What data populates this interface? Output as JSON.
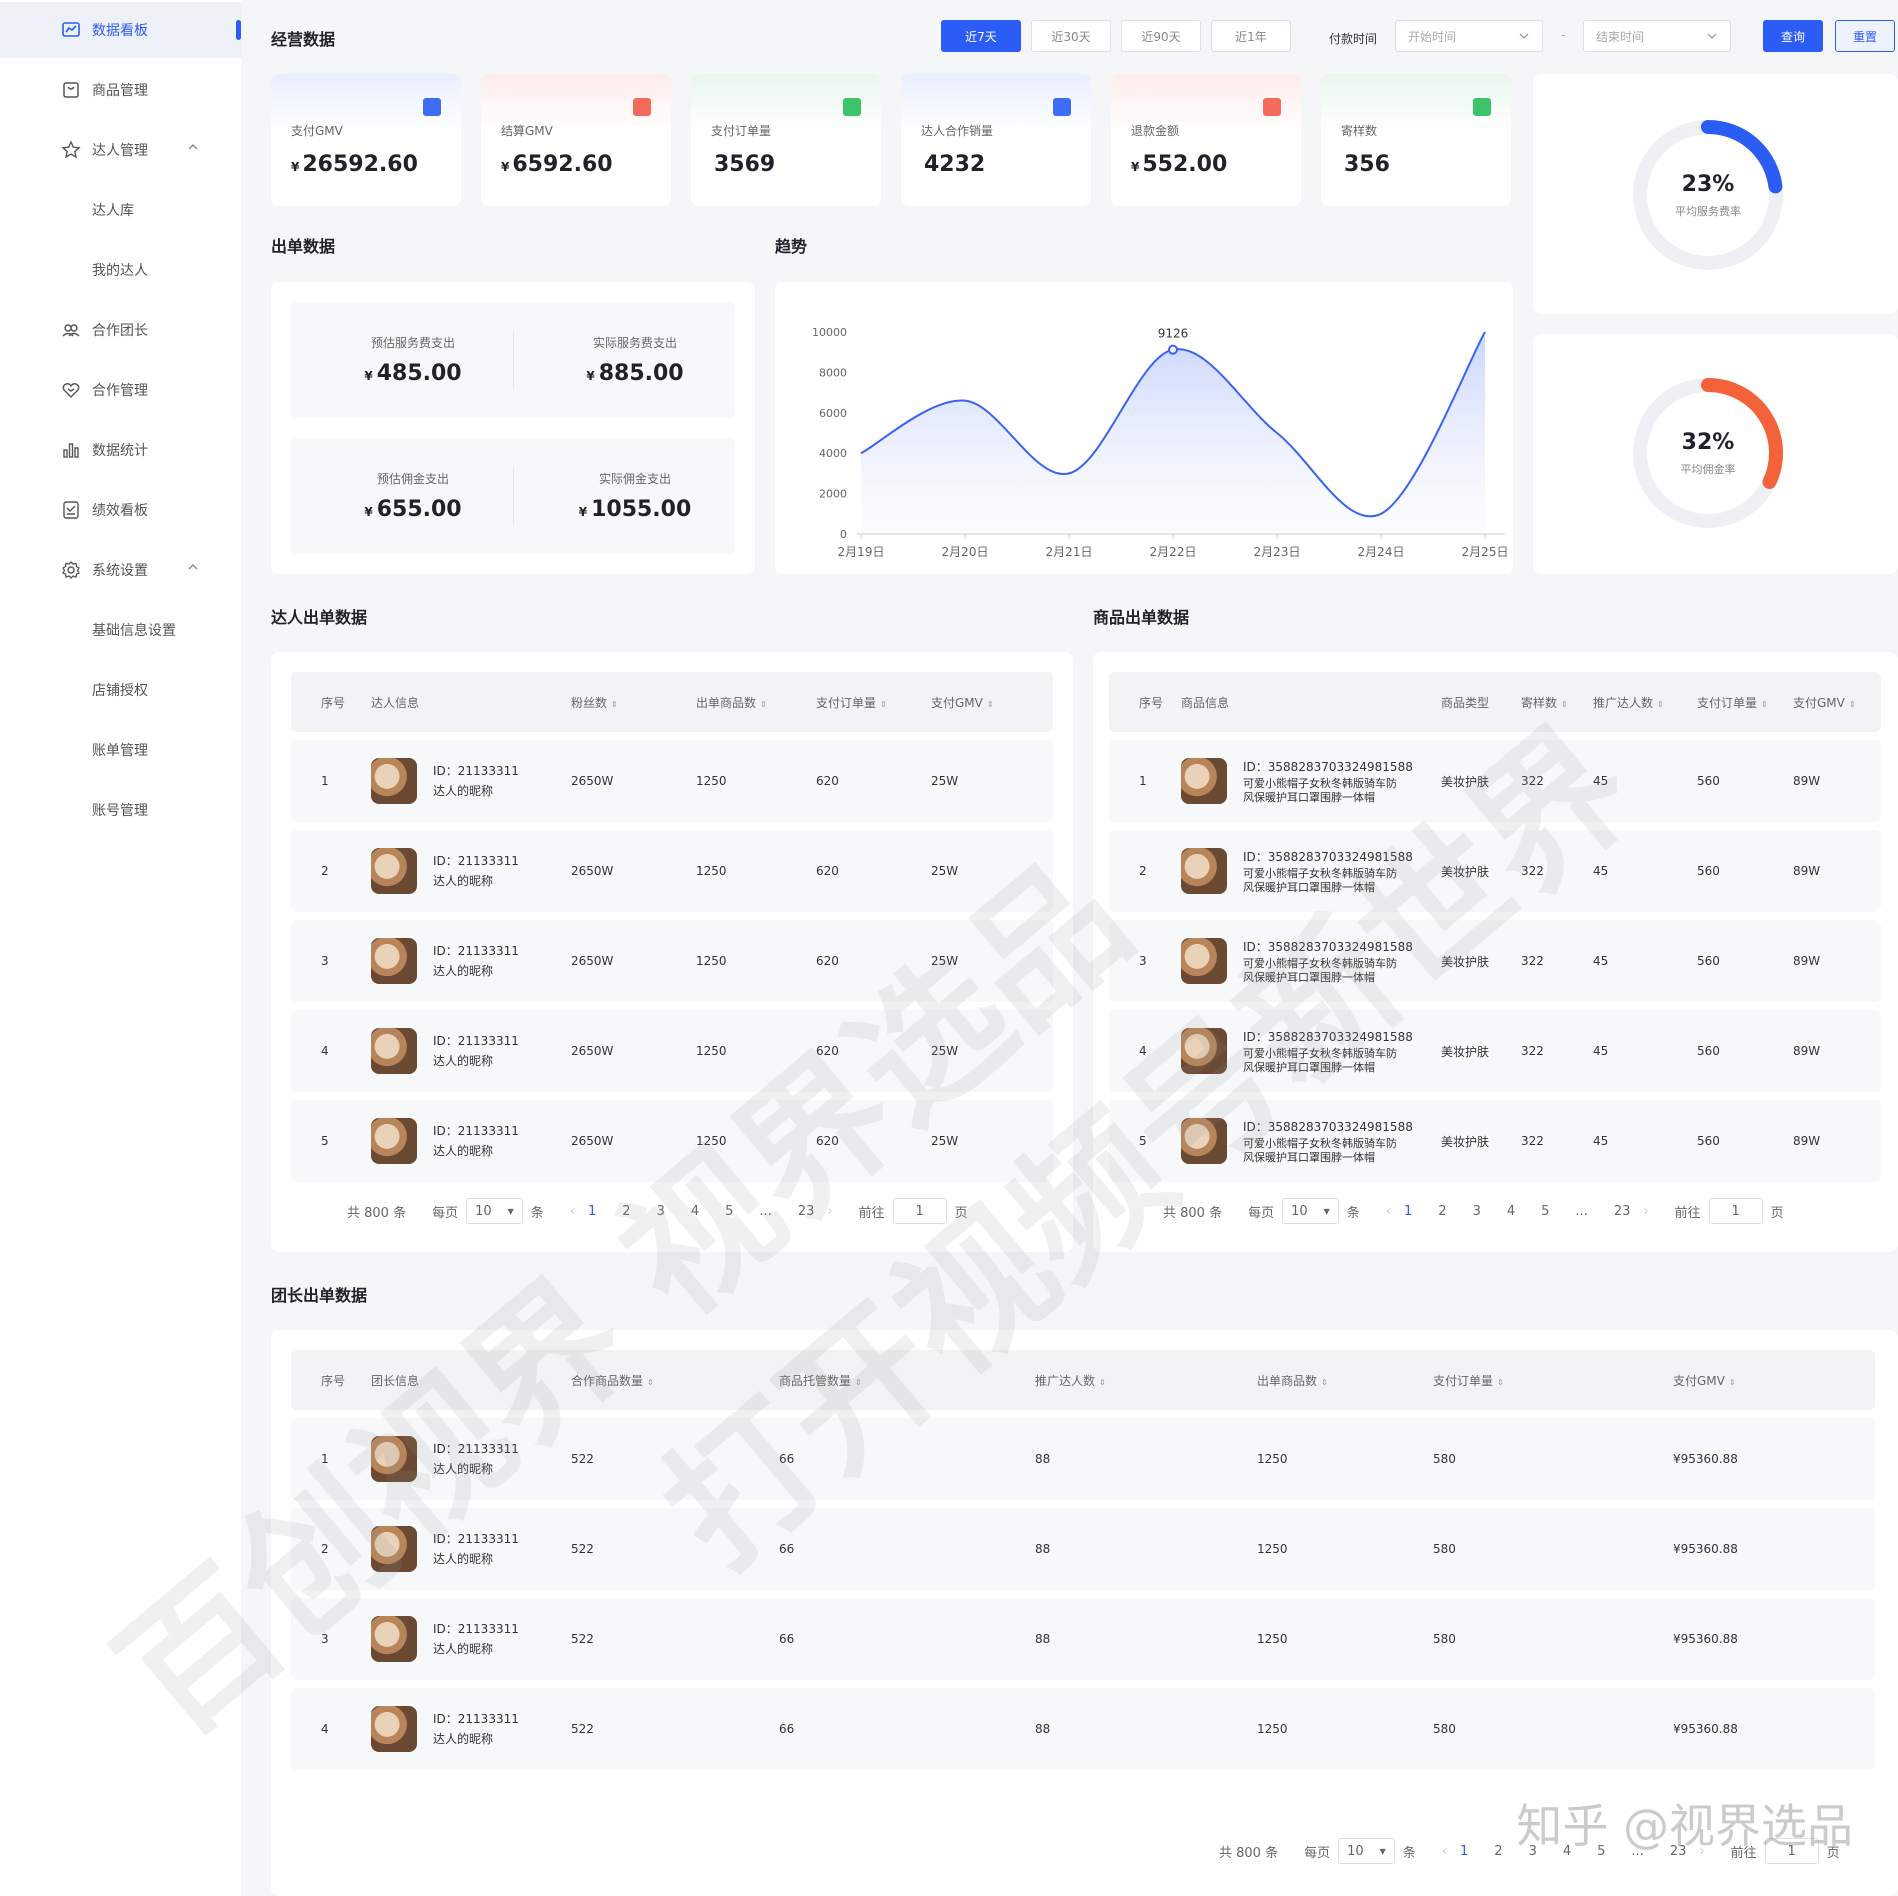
{
  "sidebar": {
    "items": [
      {
        "label": "数据看板",
        "icon": "dashboard-icon",
        "active": true
      },
      {
        "label": "商品管理",
        "icon": "product-icon"
      },
      {
        "label": "达人管理",
        "icon": "star-icon",
        "expanded": true
      },
      {
        "label": "达人库",
        "sub": true
      },
      {
        "label": "我的达人",
        "sub": true
      },
      {
        "label": "合作团长",
        "icon": "team-icon"
      },
      {
        "label": "合作管理",
        "icon": "handshake-icon"
      },
      {
        "label": "数据统计",
        "icon": "bar-chart-icon"
      },
      {
        "label": "绩效看板",
        "icon": "report-icon"
      },
      {
        "label": "系统设置",
        "icon": "gear-icon",
        "expanded": true
      },
      {
        "label": "基础信息设置",
        "sub": true
      },
      {
        "label": "店铺授权",
        "sub": true
      },
      {
        "label": "账单管理",
        "sub": true
      },
      {
        "label": "账号管理",
        "sub": true
      }
    ]
  },
  "header": {
    "title": "经营数据",
    "ranges": [
      "近7天",
      "近30天",
      "近90天",
      "近1年"
    ],
    "pay_time_label": "付款时间",
    "start_placeholder": "开始时间",
    "dash": "-",
    "end_placeholder": "结束时间",
    "query_label": "查询",
    "reset_label": "重置"
  },
  "kpis": [
    {
      "label": "支付GMV",
      "currency": "¥",
      "value": "26592.60",
      "icon_color": "#3f6cf6"
    },
    {
      "label": "结算GMV",
      "currency": "¥",
      "value": "6592.60",
      "icon_color": "#f26b5b"
    },
    {
      "label": "支付订单量",
      "currency": "",
      "value": "3569",
      "icon_color": "#3cc46a"
    },
    {
      "label": "达人合作销量",
      "currency": "",
      "value": "4232",
      "icon_color": "#3f6cf6"
    },
    {
      "label": "退款金额",
      "currency": "¥",
      "value": "552.00",
      "icon_color": "#f26b5b"
    },
    {
      "label": "寄样数",
      "currency": "",
      "value": "356",
      "icon_color": "#3cc46a"
    }
  ],
  "rings": [
    {
      "value": "23%",
      "fraction": 0.23,
      "label": "平均服务费率",
      "color": "#2b5cf6"
    },
    {
      "value": "32%",
      "fraction": 0.32,
      "label": "平均佣金率",
      "color": "#f4623a"
    }
  ],
  "order_section": {
    "title": "出单数据",
    "items": [
      {
        "label": "预估服务费支出",
        "currency": "¥",
        "value": "485.00"
      },
      {
        "label": "实际服务费支出",
        "currency": "¥",
        "value": "885.00"
      },
      {
        "label": "预估佣金支出",
        "currency": "¥",
        "value": "655.00"
      },
      {
        "label": "实际佣金支出",
        "currency": "¥",
        "value": "1055.00"
      }
    ]
  },
  "trend_title": "趋势",
  "chart_data": {
    "type": "area",
    "categories": [
      "2月19日",
      "2月20日",
      "2月21日",
      "2月22日",
      "2月23日",
      "2月24日",
      "2月25日"
    ],
    "values": [
      4000,
      6600,
      3000,
      9126,
      5000,
      1000,
      10000
    ],
    "peak_label": "9126",
    "ylim": [
      0,
      10000
    ],
    "yticks": [
      "0",
      "2000",
      "4000",
      "6000",
      "8000",
      "10000"
    ],
    "color": "#3a63f0"
  },
  "influencer_table": {
    "title": "达人出单数据",
    "columns": [
      "序号",
      "达人信息",
      "粉丝数",
      "出单商品数",
      "支付订单量",
      "支付GMV"
    ],
    "rows": [
      {
        "no": "1",
        "id": "ID：21133311",
        "nick": "达人的昵称",
        "fans": "2650W",
        "products": "1250",
        "orders": "620",
        "gmv": "25W"
      },
      {
        "no": "2",
        "id": "ID：21133311",
        "nick": "达人的昵称",
        "fans": "2650W",
        "products": "1250",
        "orders": "620",
        "gmv": "25W"
      },
      {
        "no": "3",
        "id": "ID：21133311",
        "nick": "达人的昵称",
        "fans": "2650W",
        "products": "1250",
        "orders": "620",
        "gmv": "25W"
      },
      {
        "no": "4",
        "id": "ID：21133311",
        "nick": "达人的昵称",
        "fans": "2650W",
        "products": "1250",
        "orders": "620",
        "gmv": "25W"
      },
      {
        "no": "5",
        "id": "ID：21133311",
        "nick": "达人的昵称",
        "fans": "2650W",
        "products": "1250",
        "orders": "620",
        "gmv": "25W"
      }
    ]
  },
  "product_table": {
    "title": "商品出单数据",
    "columns": [
      "序号",
      "商品信息",
      "商品类型",
      "寄样数",
      "推广达人数",
      "支付订单量",
      "支付GMV"
    ],
    "rows": [
      {
        "no": "1",
        "id": "ID：3588283703324981588",
        "name": "可爱小熊帽子女秋冬韩版骑车防风保暖护耳口罩围脖一体帽",
        "type": "美妆护肤",
        "samples": "322",
        "promoters": "45",
        "orders": "560",
        "gmv": "89W"
      },
      {
        "no": "2",
        "id": "ID：3588283703324981588",
        "name": "可爱小熊帽子女秋冬韩版骑车防风保暖护耳口罩围脖一体帽",
        "type": "美妆护肤",
        "samples": "322",
        "promoters": "45",
        "orders": "560",
        "gmv": "89W"
      },
      {
        "no": "3",
        "id": "ID：3588283703324981588",
        "name": "可爱小熊帽子女秋冬韩版骑车防风保暖护耳口罩围脖一体帽",
        "type": "美妆护肤",
        "samples": "322",
        "promoters": "45",
        "orders": "560",
        "gmv": "89W"
      },
      {
        "no": "4",
        "id": "ID：3588283703324981588",
        "name": "可爱小熊帽子女秋冬韩版骑车防风保暖护耳口罩围脖一体帽",
        "type": "美妆护肤",
        "samples": "322",
        "promoters": "45",
        "orders": "560",
        "gmv": "89W"
      },
      {
        "no": "5",
        "id": "ID：3588283703324981588",
        "name": "可爱小熊帽子女秋冬韩版骑车防风保暖护耳口罩围脖一体帽",
        "type": "美妆护肤",
        "samples": "322",
        "promoters": "45",
        "orders": "560",
        "gmv": "89W"
      }
    ]
  },
  "leader_table": {
    "title": "团长出单数据",
    "columns": [
      "序号",
      "团长信息",
      "合作商品数量",
      "商品托管数量",
      "推广达人数",
      "出单商品数",
      "支付订单量",
      "支付GMV"
    ],
    "rows": [
      {
        "no": "1",
        "id": "ID：21133311",
        "nick": "达人的昵称",
        "coop": "522",
        "hosted": "66",
        "promoters": "88",
        "products": "1250",
        "orders": "580",
        "gmv": "¥95360.88"
      },
      {
        "no": "2",
        "id": "ID：21133311",
        "nick": "达人的昵称",
        "coop": "522",
        "hosted": "66",
        "promoters": "88",
        "products": "1250",
        "orders": "580",
        "gmv": "¥95360.88"
      },
      {
        "no": "3",
        "id": "ID：21133311",
        "nick": "达人的昵称",
        "coop": "522",
        "hosted": "66",
        "promoters": "88",
        "products": "1250",
        "orders": "580",
        "gmv": "¥95360.88"
      },
      {
        "no": "4",
        "id": "ID：21133311",
        "nick": "达人的昵称",
        "coop": "522",
        "hosted": "66",
        "promoters": "88",
        "products": "1250",
        "orders": "580",
        "gmv": "¥95360.88"
      }
    ]
  },
  "pager": {
    "total": "共 800 条",
    "per_page": "每页",
    "size": "10",
    "unit": "条",
    "pages": [
      "1",
      "2",
      "3",
      "4",
      "5",
      "...",
      "23"
    ],
    "goto": "前往",
    "goto_value": "1",
    "page_unit": "页"
  },
  "watermarks": [
    "百创视界 视界选品",
    "打开视频号新世界"
  ],
  "zhihu": "知乎 @视界选品"
}
